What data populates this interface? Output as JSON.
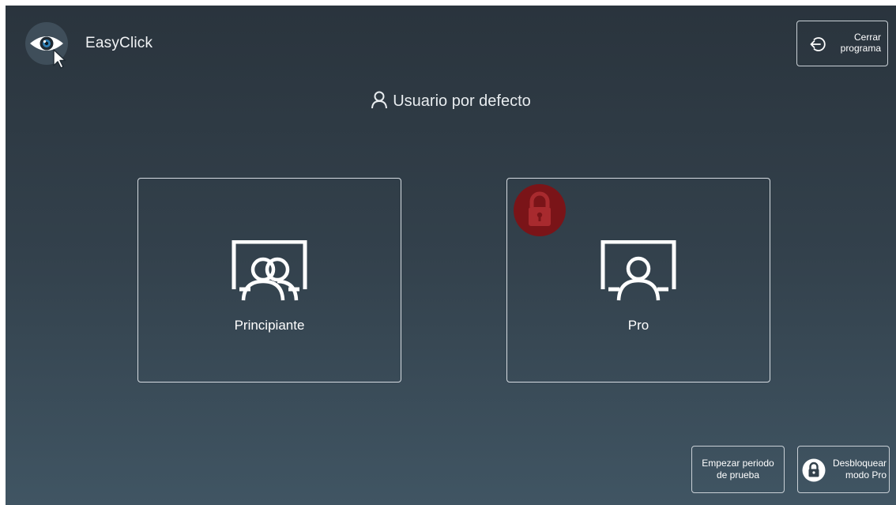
{
  "app": {
    "title": "EasyClick",
    "logo_icon": "eye-cursor-icon"
  },
  "header": {
    "close_button": {
      "icon": "exit-icon",
      "label": "Cerrar\nprograma"
    }
  },
  "user": {
    "icon": "user-icon",
    "name": "Usuario por defecto"
  },
  "modes": [
    {
      "label": "Principiante",
      "icon": "two-users-screen-icon",
      "locked": false
    },
    {
      "label": "Pro",
      "icon": "single-user-screen-icon",
      "locked": true,
      "lock_icon": "padlock-icon"
    }
  ],
  "footer": {
    "trial_button": {
      "label": "Empezar periodo\nde prueba"
    },
    "unlock_button": {
      "icon": "padlock-icon",
      "label": "Desbloquear\nmodo Pro"
    }
  },
  "colors": {
    "background_top": "#2a343d",
    "background_bottom": "#405563",
    "border": "#d6dce1",
    "lock_badge": "#7a1418",
    "logo_circle": "#3f4e5a"
  }
}
